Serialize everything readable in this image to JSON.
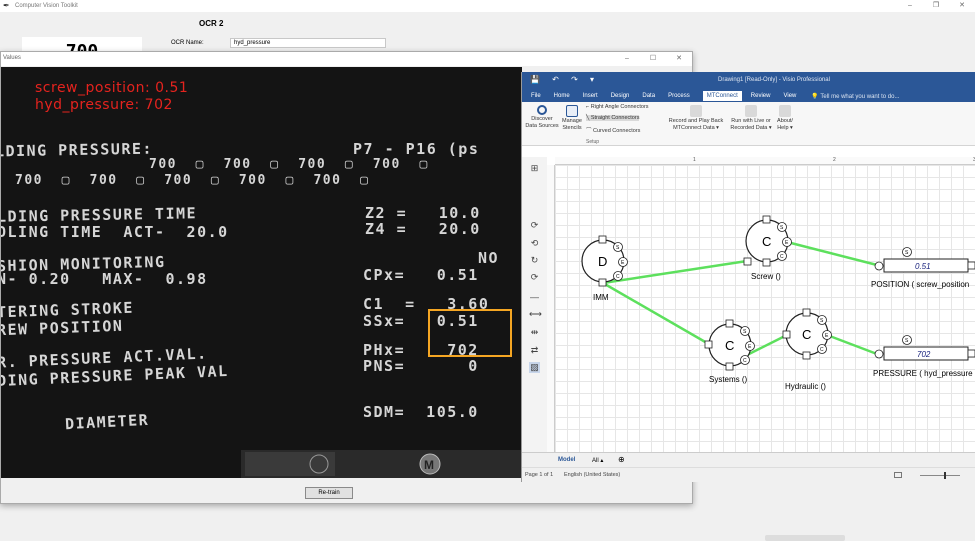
{
  "toolkit": {
    "title": "Computer Vision Toolkit",
    "ocr_title": "OCR 2",
    "ocr_readout": "700",
    "ocr_name_label": "OCR Name:",
    "ocr_name_value": "hyd_pressure",
    "controls": {
      "minimize": "–",
      "maximize": "❐",
      "close": "✕"
    }
  },
  "values_window": {
    "title": "Values",
    "controls": {
      "minimize": "–",
      "maximize": "☐",
      "close": "✕"
    },
    "overlay": {
      "screw_position": "screw_position: 0.51",
      "hyd_pressure": "hyd_pressure: 702"
    },
    "screen_lines": [
      "LDING PRESSURE:",
      "P7 - P16 (ps",
      "700  ▢  700  ▢  700  ▢  700  ▢",
      "700  ▢  700  ▢  700  ▢  700  ▢  700  ▢",
      "LDING PRESSURE TIME",
      "Z2 =   10.0",
      "OLING TIME  ACT-  20.0",
      "Z4 =   20.0",
      "NO",
      "SHION MONITORING",
      "N- 0.20   MAX-  0.98",
      "CPx=   0.51",
      "TERING STROKE",
      "C1  =   3.60",
      "REW POSITION",
      "SSx=   0.51",
      "R. PRESSURE ACT.VAL.",
      "PHx=    702",
      "DING PRESSURE PEAK VAL",
      "PNS=      0",
      "SDM=  105.0",
      "DIAMETER"
    ],
    "retrain_label": "Re-train"
  },
  "visio": {
    "window_title": "Drawing1 [Read-Only] - Visio Professional",
    "qat": "💾 ↶ ↷ ▾",
    "tabs": [
      "File",
      "Home",
      "Insert",
      "Design",
      "Data",
      "Process",
      "MTConnect",
      "Review",
      "View"
    ],
    "active_tab": "MTConnect",
    "tell_me": "💡 Tell me what you want to do...",
    "ribbon": {
      "discover": "Discover\nData Sources",
      "manage": "Manage\nStencils",
      "right_angle": "Right Angle Connectors",
      "straight": "Straight Connectors",
      "curved": "Curved Connectors",
      "group_label": "Setup",
      "record": "Record and Play Back\nMTConnect Data ▾",
      "run_live": "Run with Live or\nRecorded Data ▾",
      "about": "About/\nHelp ▾"
    },
    "ruler_marks": [
      "1",
      "2",
      "3"
    ],
    "diagram": {
      "nodes": {
        "imm": {
          "letter": "D",
          "label": "IMM"
        },
        "screw": {
          "letter": "C",
          "label": "Screw ()"
        },
        "systems": {
          "letter": "C",
          "label": "Systems ()"
        },
        "hydraulic": {
          "letter": "C",
          "label": "Hydraulic ()"
        }
      },
      "port_letters": {
        "s": "S",
        "e": "E",
        "c": "C",
        "t": "T"
      },
      "outputs": {
        "position": {
          "value": "0.51",
          "label": "POSITION ( screw_position"
        },
        "pressure": {
          "value": "702",
          "label": "PRESSURE ( hyd_pressure"
        }
      }
    },
    "page_tabs": {
      "model": "Model",
      "all": "All ▴",
      "add": "⊕"
    },
    "status": {
      "page": "Page 1 of 1",
      "language": "English (United States)"
    },
    "colors": {
      "accent": "#2b5797",
      "connector": "#5de05d"
    }
  }
}
